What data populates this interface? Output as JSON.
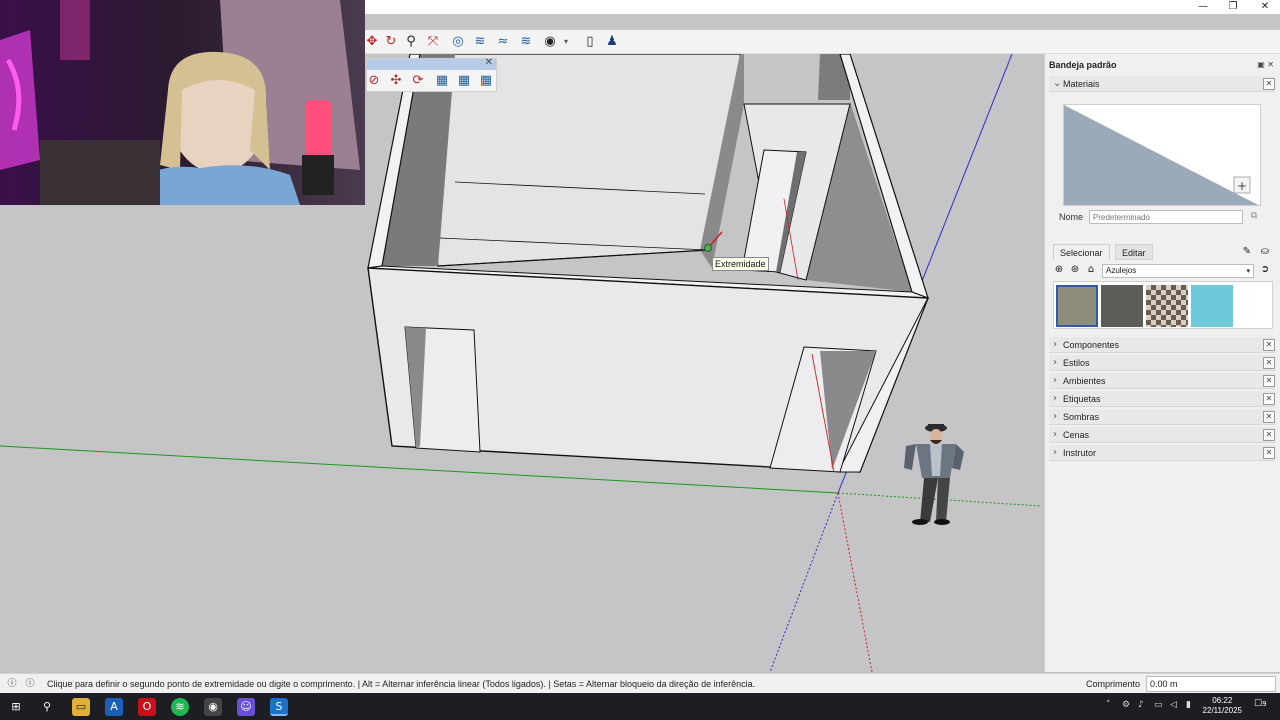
{
  "window": {
    "minimize_glyph": "—",
    "restore_glyph": "❐",
    "close_glyph": "✕"
  },
  "toolbar": {
    "icons": [
      "pan-icon",
      "orbit-icon",
      "zoom-icon",
      "zoom-extents-icon",
      "position-camera-icon",
      "sandbox-icon",
      "stamp-icon",
      "drape-icon",
      "account-icon",
      "new-file-icon",
      "profile-icon"
    ]
  },
  "float_toolbar": {
    "close_glyph": "✕"
  },
  "viewport": {
    "tooltip": "Extremidade"
  },
  "panel": {
    "title": "Bandeja padrão",
    "materials": {
      "label": "Materiais",
      "name_label": "Nome",
      "name_placeholder": "Predeterminado",
      "tab_select": "Selecionar",
      "tab_edit": "Editar",
      "library": "Azulejos"
    },
    "sections": [
      {
        "label": "Componentes"
      },
      {
        "label": "Estilos"
      },
      {
        "label": "Ambientes"
      },
      {
        "label": "Etiquetas"
      },
      {
        "label": "Sombras"
      },
      {
        "label": "Cenas"
      },
      {
        "label": "Instrutor"
      }
    ],
    "close_glyph": "✕"
  },
  "status": {
    "message": "Clique para definir o segundo ponto de extremidade ou digite o comprimento. | Alt = Alternar inferência linear (Todos ligados). | Setas = Alternar bloqueio da direção de inferência.",
    "measure_label": "Comprimento",
    "measure_value": "0.00 m"
  },
  "taskbar": {
    "time": "06:22",
    "date": "22/11/2025",
    "notification_count": "9"
  },
  "colors": {
    "accent": "#2f5aa8",
    "viewport_bg": "#c5c5c8",
    "axis_red": "#d02020",
    "axis_green": "#1a9a1a",
    "axis_blue": "#2a2ad0"
  }
}
